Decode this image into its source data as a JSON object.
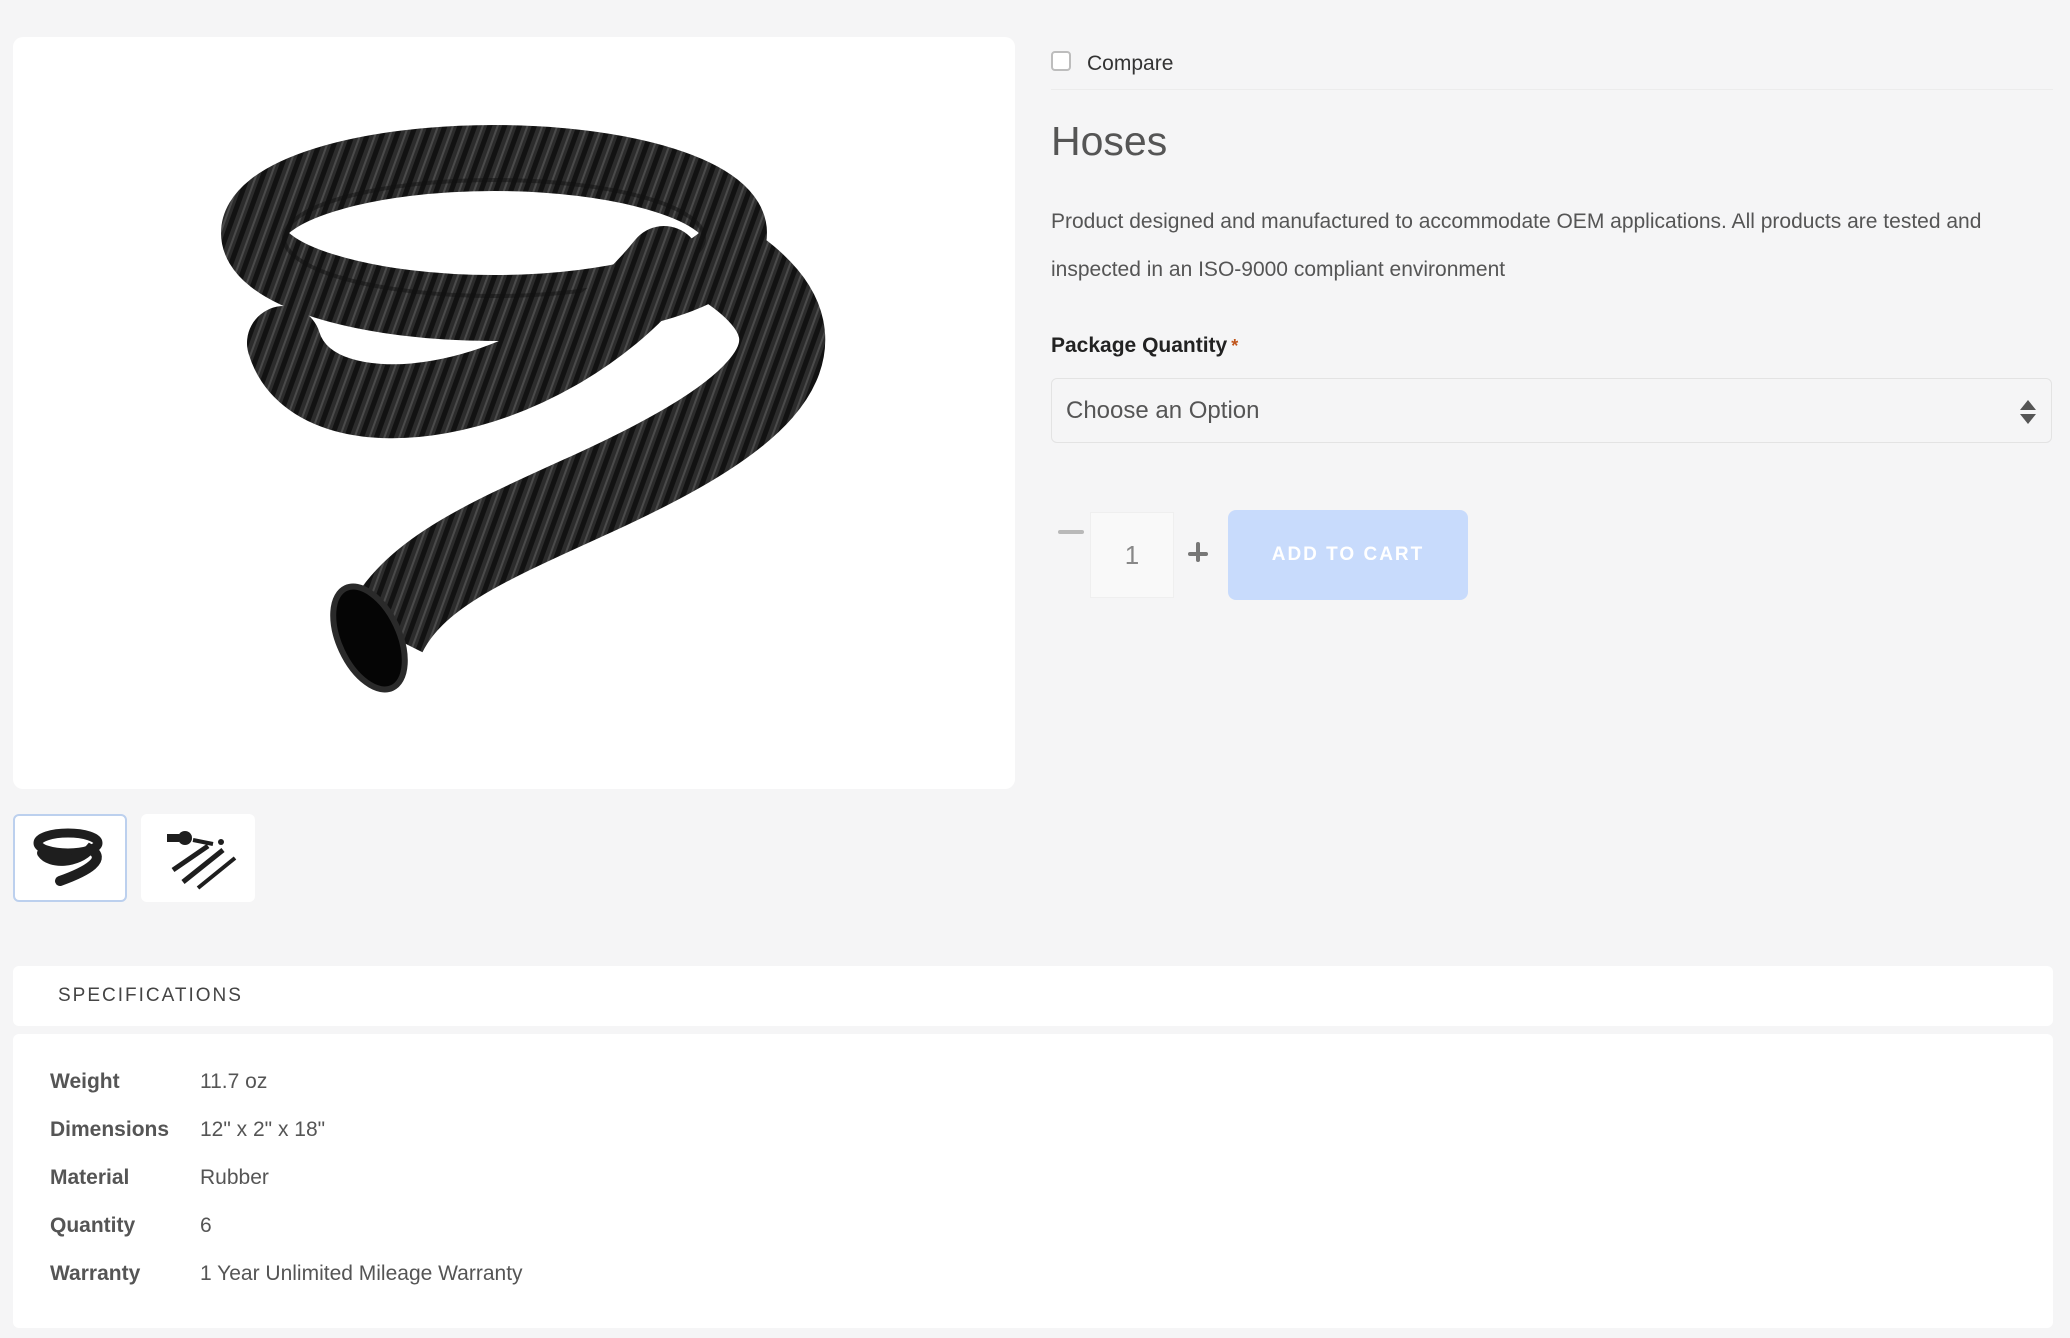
{
  "product": {
    "title": "Hoses",
    "description": "Product designed and manufactured to accommodate OEM applications. All products are tested and inspected in an ISO-9000 compliant environment"
  },
  "compare": {
    "label": "Compare",
    "checked": false
  },
  "options": {
    "label": "Package Quantity",
    "required_marker": "*",
    "select_value": "Choose an Option"
  },
  "cart": {
    "quantity": "1",
    "add_label": "ADD TO CART"
  },
  "gallery": {
    "main_image": "hose-image",
    "thumbnails": [
      "hose-thumbnail",
      "hose-kit-thumbnail"
    ]
  },
  "specifications": {
    "tab_label": "SPECIFICATIONS",
    "rows": [
      {
        "key": "Weight",
        "value": "11.7 oz"
      },
      {
        "key": "Dimensions",
        "value": "12\" x 2\" x 18\""
      },
      {
        "key": "Material",
        "value": "Rubber"
      },
      {
        "key": "Quantity",
        "value": "6"
      },
      {
        "key": "Warranty",
        "value": "1 Year Unlimited Mileage Warranty"
      }
    ]
  },
  "colors": {
    "accent_button": "#c8dbfc",
    "required": "#c0541a",
    "background": "#f5f5f6"
  }
}
